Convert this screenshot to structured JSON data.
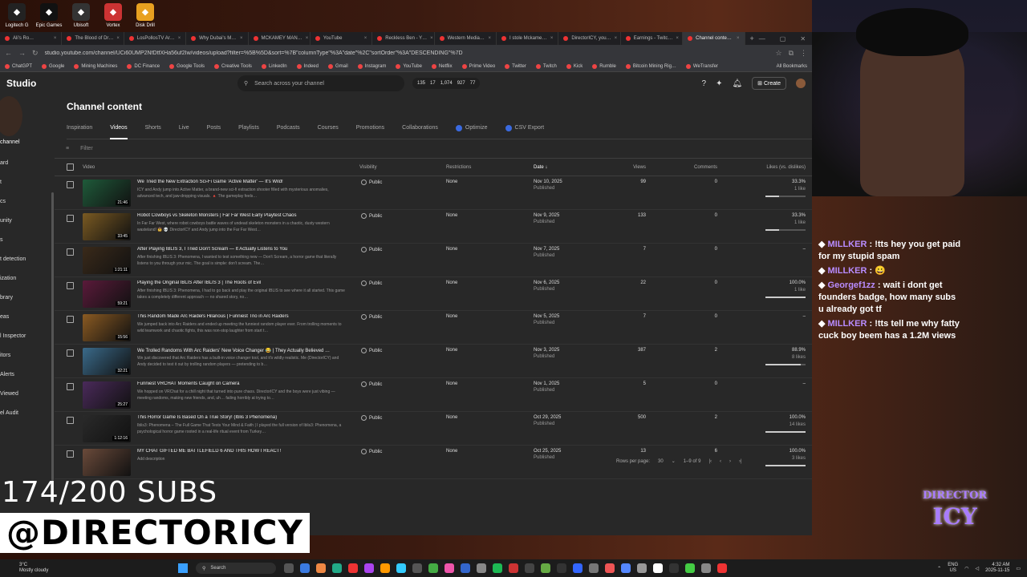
{
  "desktop_icons": [
    "Logitech G",
    "Epic Games",
    "Ubisoft",
    "Vortex",
    "Disk Drill"
  ],
  "tabs": [
    "Ali's Ro…",
    "The Blood of Dr…",
    "LosPollosTV Ar…",
    "Why Dubai's M…",
    "MCKAMEY MAN…",
    "YouTube",
    "Reckless Ben - Y…",
    "Western Media…",
    "I stole Mckame…",
    "DirectorICY, you…",
    "Earnings - Twitc…",
    "Channel conte…"
  ],
  "url": "studio.youtube.com/channel/UCi60UMP2NfDtfXHa56uf2Iw/videos/upload?filter=%5B%5D&sort=%7B\"columnType\"%3A\"date\"%2C\"sortOrder\"%3A\"DESCENDING\"%7D",
  "bookmarks": [
    "ChatGPT",
    "Google",
    "Mining Machines",
    "DC Finance",
    "Google Tools",
    "Creative Tools",
    "LinkedIn",
    "Indeed",
    "Gmail",
    "Instagram",
    "YouTube",
    "Netflix",
    "Prime Video",
    "Twitter",
    "Twitch",
    "Kick",
    "Rumble",
    "Bitcoin Mining Rig…",
    "WeTransfer"
  ],
  "all_bookmarks": "All Bookmarks",
  "studio": {
    "logo": "Studio",
    "search_placeholder": "Search across your channel",
    "stats": [
      "135",
      "17",
      "1,074",
      "927",
      "77"
    ],
    "create": "Create",
    "channel_label": "channel"
  },
  "sidebar_items": [
    "ard",
    "t",
    "cs",
    "unity",
    "s",
    "t detection",
    "ization",
    "brary",
    "eas",
    "l Inspector",
    "itors",
    "Alerts",
    "Viewed",
    "el Audit"
  ],
  "page_title": "Channel content",
  "content_tabs": [
    "Inspiration",
    "Videos",
    "Shorts",
    "Live",
    "Posts",
    "Playlists",
    "Podcasts",
    "Courses",
    "Promotions",
    "Collaborations",
    "Optimize",
    "CSV Export"
  ],
  "filter_label": "Filter",
  "columns": {
    "video": "Video",
    "visibility": "Visibility",
    "restrictions": "Restrictions",
    "date": "Date ↓",
    "views": "Views",
    "comments": "Comments",
    "likes": "Likes (vs. dislikes)"
  },
  "videos": [
    {
      "title": "We Tried the New Extraction Sci-Fi Game 'Active Matter' — It's Wild!",
      "desc": "ICY and Andy jump into Active Matter, a brand-new sci-fi extraction shooter filled with mysterious anomalies, advanced tech, and jaw-dropping visuals. 🔺 The gameplay feels…",
      "duration": "21:46",
      "visibility": "Public",
      "restrictions": "None",
      "date": "Nov 10, 2025",
      "status": "Published",
      "views": "99",
      "comments": "0",
      "likes": "33.3%",
      "likes_sub": "1 like",
      "like_ratio": 0.333,
      "thumb": "#1f5a3a"
    },
    {
      "title": "Robot Cowboys vs Skeleton Monsters | Far Far West Early Playtest Chaos",
      "desc": "In Far Far West, where robot cowboys battle waves of undead skeleton monsters in a chaotic, dusty western wasteland! 🤠 💀 DirectorICY and Andy jump into the Far Far West…",
      "duration": "33:45",
      "visibility": "Public",
      "restrictions": "None",
      "date": "Nov 9, 2025",
      "status": "Published",
      "views": "133",
      "comments": "0",
      "likes": "33.3%",
      "likes_sub": "1 like",
      "like_ratio": 0.333,
      "thumb": "#7a5a22"
    },
    {
      "title": "After Playing IBLIS 3, I Tried Don't Scream — It Actually Listens to You",
      "desc": "After finishing IBLIS 3: Phenomena, I wanted to test something new — Don't Scream, a horror game that literally listens to you through your mic. The goal is simple: don't scream. The…",
      "duration": "1:21:11",
      "visibility": "Public",
      "restrictions": "None",
      "date": "Nov 7, 2025",
      "status": "Published",
      "views": "7",
      "comments": "0",
      "likes": "–",
      "likes_sub": "",
      "like_ratio": null,
      "thumb": "#3a2a1a"
    },
    {
      "title": "Playing the Original IBLIS After IBLIS 3 | The Roots of Evil",
      "desc": "After finishing IBLIS 3: Phenomena, I had to go back and play the original IBLIS to see where it all started. This game takes a completely different approach — no shared story, no…",
      "duration": "59:21",
      "visibility": "Public",
      "restrictions": "None",
      "date": "Nov 6, 2025",
      "status": "Published",
      "views": "22",
      "comments": "0",
      "likes": "100.0%",
      "likes_sub": "1 like",
      "like_ratio": 1.0,
      "thumb": "#5a1a3a"
    },
    {
      "title": "This Random Made Arc Raiders Hilarious | Funniest Trio in Arc Raiders",
      "desc": "We jumped back into Arc Raiders and ended up meeting the funniest random player ever. From trolling moments to wild teamwork and chaotic fights, this was non-stop laughter from start t…",
      "duration": "15:56",
      "visibility": "Public",
      "restrictions": "None",
      "date": "Nov 5, 2025",
      "status": "Published",
      "views": "7",
      "comments": "0",
      "likes": "–",
      "likes_sub": "",
      "like_ratio": null,
      "thumb": "#8a5a22"
    },
    {
      "title": "We Trolled Randoms With Arc Raiders' New Voice Changer 😂 | They Actually Believed …",
      "desc": "We just discovered that Arc Raiders has a built-in voice changer tool, and it's wildly realistic. Me (DirectorICY) and Andy decided to test it out by trolling random players — pretending to b…",
      "duration": "32:21",
      "visibility": "Public",
      "restrictions": "None",
      "date": "Nov 3, 2025",
      "status": "Published",
      "views": "387",
      "comments": "2",
      "likes": "88.9%",
      "likes_sub": "8 likes",
      "like_ratio": 0.889,
      "thumb": "#3a6a8a"
    },
    {
      "title": "Funniest VRCHAT Moments Caught on Camera",
      "desc": "We hopped on VRChat for a chill night that turned into pure chaos. DirectorICY and the boys were just vibing — meeting randoms, making new friends, and, uh… failing horribly at trying to…",
      "duration": "25:27",
      "visibility": "Public",
      "restrictions": "None",
      "date": "Nov 1, 2025",
      "status": "Published",
      "views": "5",
      "comments": "0",
      "likes": "–",
      "likes_sub": "",
      "like_ratio": null,
      "thumb": "#4a2a5a"
    },
    {
      "title": "This Horror Game Is Based On a True Story! (Iblis 3 Phenomena)",
      "desc": "Iblis3: Phenomena – The Full Game That Tests Your Mind & Faith | I played the full version of Iblis3: Phenomena, a psychological horror game rooted in a real-life ritual event from Turkey…",
      "duration": "1:12:16",
      "visibility": "Public",
      "restrictions": "None",
      "date": "Oct 29, 2025",
      "status": "Published",
      "views": "500",
      "comments": "2",
      "likes": "100.0%",
      "likes_sub": "14 likes",
      "like_ratio": 1.0,
      "thumb": "#2a2a2a"
    },
    {
      "title": "MY CHAT GIFTED ME BATTLEFIELD 6 AND THIS HOW I REACT!",
      "desc": "Add description",
      "duration": "",
      "visibility": "Public",
      "restrictions": "None",
      "date": "Oct 25, 2025",
      "status": "Published",
      "views": "13",
      "comments": "6",
      "likes": "100.0%",
      "likes_sub": "3 likes",
      "like_ratio": 1.0,
      "thumb": "#6a4a3a"
    }
  ],
  "pager": {
    "rows_label": "Rows per page:",
    "rows_value": "30",
    "range": "1–9 of 9"
  },
  "chat": [
    {
      "name": "MILLKER",
      "msg": "!tts hey you get paid for my stupid spam"
    },
    {
      "name": "MILLKER",
      "msg": "😀"
    },
    {
      "name": "Georgef1zz",
      "msg": "wait i dont get founders badge, how many subs u already got tf"
    },
    {
      "name": "MILLKER",
      "msg": "!tts tell me why fatty cuck boy beem has a 1.2M views"
    }
  ],
  "overlay": {
    "subs": "174/200 SUBS",
    "handle": "@DIRECTORICY",
    "logo_top": "DIRECTOR",
    "logo_bottom": "ICY"
  },
  "taskbar": {
    "temp": "3°C",
    "weather": "Mostly cloudy",
    "search": "Search",
    "lang": "ENG",
    "region": "US",
    "time": "4:32 AM",
    "date": "2025-11-15"
  }
}
